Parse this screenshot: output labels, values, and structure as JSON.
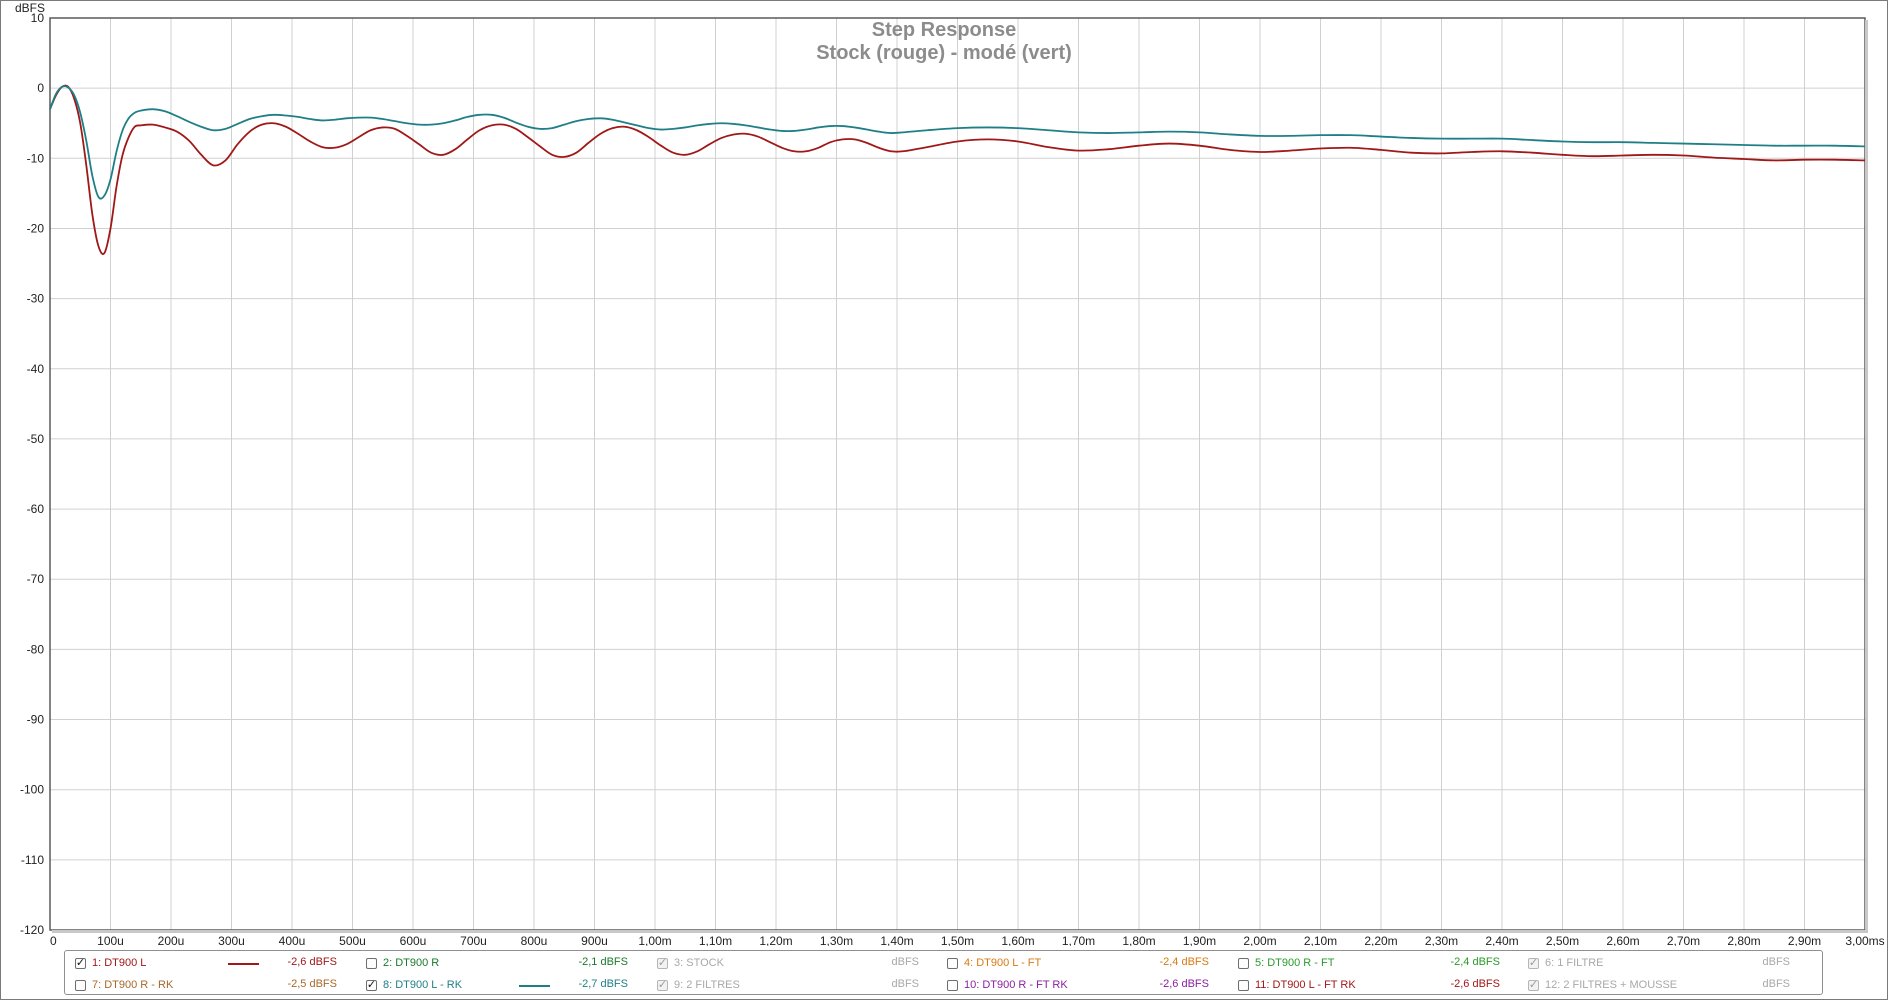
{
  "chart_data": {
    "type": "line",
    "title": "Step Response",
    "subtitle": "Stock (rouge) - modé (vert)",
    "ylabel": "dBFS",
    "xlabel": "",
    "xlim": [
      0,
      3.0
    ],
    "ylim": [
      -120,
      10
    ],
    "grid": true,
    "x_unit": "ms",
    "y_ticks": [
      10,
      0,
      -10,
      -20,
      -30,
      -40,
      -50,
      -60,
      -70,
      -80,
      -90,
      -100,
      -110,
      -120
    ],
    "y_tick_labels": [
      "10",
      "0",
      "-10",
      "-20",
      "-30",
      "-40",
      "-50",
      "-60",
      "-70",
      "-80",
      "-90",
      "-100",
      "-110",
      "-120"
    ],
    "x_ticks": [
      0,
      0.1,
      0.2,
      0.3,
      0.4,
      0.5,
      0.6,
      0.7,
      0.8,
      0.9,
      1.0,
      1.1,
      1.2,
      1.3,
      1.4,
      1.5,
      1.6,
      1.7,
      1.8,
      1.9,
      2.0,
      2.1,
      2.2,
      2.3,
      2.4,
      2.5,
      2.6,
      2.7,
      2.8,
      2.9,
      3.0
    ],
    "x_tick_labels": [
      "0",
      "100u",
      "200u",
      "300u",
      "400u",
      "500u",
      "600u",
      "700u",
      "800u",
      "900u",
      "1,00m",
      "1,10m",
      "1,20m",
      "1,30m",
      "1,40m",
      "1,50m",
      "1,60m",
      "1,70m",
      "1,80m",
      "1,90m",
      "2,00m",
      "2,10m",
      "2,20m",
      "2,30m",
      "2,40m",
      "2,50m",
      "2,60m",
      "2,70m",
      "2,80m",
      "2,90m",
      "3,00ms"
    ],
    "series": [
      {
        "name": "1: DT900 L",
        "color": "#a01818",
        "x": [
          0,
          0.01,
          0.02,
          0.03,
          0.04,
          0.05,
          0.06,
          0.07,
          0.08,
          0.09,
          0.1,
          0.11,
          0.12,
          0.13,
          0.14,
          0.15,
          0.17,
          0.19,
          0.21,
          0.23,
          0.25,
          0.27,
          0.29,
          0.31,
          0.33,
          0.35,
          0.37,
          0.39,
          0.41,
          0.43,
          0.45,
          0.47,
          0.49,
          0.51,
          0.53,
          0.55,
          0.57,
          0.59,
          0.61,
          0.63,
          0.65,
          0.67,
          0.69,
          0.71,
          0.73,
          0.75,
          0.77,
          0.79,
          0.81,
          0.83,
          0.85,
          0.87,
          0.89,
          0.91,
          0.93,
          0.95,
          0.97,
          0.99,
          1.01,
          1.03,
          1.05,
          1.07,
          1.09,
          1.11,
          1.13,
          1.15,
          1.17,
          1.19,
          1.21,
          1.23,
          1.25,
          1.27,
          1.29,
          1.31,
          1.33,
          1.35,
          1.37,
          1.39,
          1.41,
          1.45,
          1.5,
          1.55,
          1.6,
          1.65,
          1.7,
          1.75,
          1.8,
          1.85,
          1.9,
          1.95,
          2.0,
          2.05,
          2.1,
          2.15,
          2.2,
          2.25,
          2.3,
          2.35,
          2.4,
          2.45,
          2.5,
          2.55,
          2.6,
          2.65,
          2.7,
          2.75,
          2.8,
          2.85,
          2.9,
          2.95,
          3.0
        ],
        "y": [
          -3,
          -1,
          0.2,
          0.2,
          -1.5,
          -5,
          -11,
          -18,
          -22.5,
          -23.5,
          -20,
          -14,
          -9.5,
          -7,
          -5.5,
          -5.3,
          -5.2,
          -5.6,
          -6.2,
          -7.5,
          -9.5,
          -11,
          -10.3,
          -8,
          -6.2,
          -5.2,
          -5,
          -5.5,
          -6.5,
          -7.6,
          -8.4,
          -8.5,
          -8,
          -7,
          -6,
          -5.6,
          -5.8,
          -6.8,
          -8,
          -9.2,
          -9.5,
          -8.7,
          -7.3,
          -6,
          -5.3,
          -5.2,
          -5.8,
          -7,
          -8.3,
          -9.5,
          -9.8,
          -9.2,
          -7.8,
          -6.5,
          -5.7,
          -5.5,
          -6,
          -7,
          -8.2,
          -9.2,
          -9.5,
          -9,
          -8,
          -7.1,
          -6.6,
          -6.5,
          -6.9,
          -7.7,
          -8.5,
          -9,
          -9,
          -8.5,
          -7.7,
          -7.3,
          -7.3,
          -7.8,
          -8.5,
          -9,
          -9,
          -8.4,
          -7.6,
          -7.3,
          -7.6,
          -8.4,
          -8.9,
          -8.7,
          -8.2,
          -7.9,
          -8.2,
          -8.8,
          -9.1,
          -8.9,
          -8.6,
          -8.5,
          -8.8,
          -9.2,
          -9.3,
          -9.1,
          -9,
          -9.2,
          -9.5,
          -9.7,
          -9.6,
          -9.5,
          -9.6,
          -9.9,
          -10.1,
          -10.3,
          -10.2,
          -10.2,
          -10.3
        ],
        "legend_value": "-2,6 dBFS",
        "visible": true
      },
      {
        "name": "8: DT900 L - RK",
        "color": "#1f7f86",
        "x": [
          0,
          0.01,
          0.02,
          0.03,
          0.04,
          0.05,
          0.06,
          0.07,
          0.08,
          0.09,
          0.1,
          0.11,
          0.12,
          0.13,
          0.14,
          0.15,
          0.17,
          0.19,
          0.21,
          0.23,
          0.25,
          0.27,
          0.29,
          0.31,
          0.33,
          0.35,
          0.37,
          0.39,
          0.41,
          0.43,
          0.45,
          0.47,
          0.49,
          0.51,
          0.53,
          0.55,
          0.57,
          0.59,
          0.61,
          0.63,
          0.65,
          0.67,
          0.69,
          0.71,
          0.73,
          0.75,
          0.77,
          0.79,
          0.81,
          0.83,
          0.85,
          0.87,
          0.89,
          0.91,
          0.93,
          0.95,
          0.97,
          0.99,
          1.01,
          1.03,
          1.05,
          1.07,
          1.09,
          1.11,
          1.13,
          1.15,
          1.17,
          1.19,
          1.21,
          1.23,
          1.25,
          1.27,
          1.29,
          1.31,
          1.33,
          1.35,
          1.37,
          1.39,
          1.41,
          1.45,
          1.5,
          1.55,
          1.6,
          1.65,
          1.7,
          1.75,
          1.8,
          1.85,
          1.9,
          1.95,
          2.0,
          2.05,
          2.1,
          2.15,
          2.2,
          2.25,
          2.3,
          2.35,
          2.4,
          2.45,
          2.5,
          2.55,
          2.6,
          2.65,
          2.7,
          2.75,
          2.8,
          2.85,
          2.9,
          2.95,
          3.0
        ],
        "y": [
          -3,
          -0.8,
          0.2,
          0.1,
          -1,
          -3.5,
          -7.5,
          -12.5,
          -15.5,
          -15.3,
          -13,
          -9,
          -6,
          -4.3,
          -3.5,
          -3.2,
          -3,
          -3.3,
          -4,
          -4.8,
          -5.5,
          -6,
          -5.8,
          -5.1,
          -4.4,
          -4,
          -3.8,
          -3.9,
          -4.1,
          -4.4,
          -4.6,
          -4.5,
          -4.3,
          -4.2,
          -4.2,
          -4.4,
          -4.7,
          -5,
          -5.2,
          -5.2,
          -5,
          -4.6,
          -4.1,
          -3.8,
          -3.8,
          -4.2,
          -4.9,
          -5.5,
          -5.8,
          -5.7,
          -5.2,
          -4.7,
          -4.4,
          -4.3,
          -4.5,
          -4.9,
          -5.3,
          -5.7,
          -5.9,
          -5.8,
          -5.6,
          -5.3,
          -5.1,
          -5,
          -5.1,
          -5.3,
          -5.6,
          -5.9,
          -6.1,
          -6.1,
          -5.9,
          -5.6,
          -5.4,
          -5.4,
          -5.6,
          -5.9,
          -6.2,
          -6.4,
          -6.3,
          -6,
          -5.7,
          -5.6,
          -5.7,
          -6,
          -6.3,
          -6.4,
          -6.3,
          -6.2,
          -6.3,
          -6.6,
          -6.8,
          -6.8,
          -6.7,
          -6.7,
          -6.9,
          -7.1,
          -7.2,
          -7.2,
          -7.2,
          -7.4,
          -7.6,
          -7.7,
          -7.7,
          -7.8,
          -7.9,
          -8.0,
          -8.1,
          -8.2,
          -8.2,
          -8.2,
          -8.3
        ],
        "legend_value": "-2,7 dBFS",
        "visible": true
      }
    ]
  },
  "legend": {
    "rows": [
      [
        {
          "label": "1: DT900 L",
          "value": "-2,6 dBFS",
          "color": "#a01818",
          "valueColor": "#a01818",
          "checked": true,
          "disabled": false,
          "line": true
        },
        {
          "label": "2: DT900 R",
          "value": "-2,1 dBFS",
          "color": "#1a7a2a",
          "valueColor": "#1a7a2a",
          "checked": false,
          "disabled": false,
          "line": false
        },
        {
          "label": "3: STOCK",
          "value": "dBFS",
          "color": "#a8a8a8",
          "valueColor": "#a8a8a8",
          "checked": true,
          "disabled": true,
          "line": false
        },
        {
          "label": "4: DT900 L - FT",
          "value": "-2,4 dBFS",
          "color": "#d97a10",
          "valueColor": "#d97a10",
          "checked": false,
          "disabled": false,
          "line": false
        },
        {
          "label": "5: DT900 R - FT",
          "value": "-2,4 dBFS",
          "color": "#2a9a2a",
          "valueColor": "#2a9a2a",
          "checked": false,
          "disabled": false,
          "line": false
        },
        {
          "label": "6: 1 FILTRE",
          "value": "dBFS",
          "color": "#a8a8a8",
          "valueColor": "#a8a8a8",
          "checked": true,
          "disabled": true,
          "line": false
        }
      ],
      [
        {
          "label": "7: DT900 R - RK",
          "value": "-2,5 dBFS",
          "color": "#a8682a",
          "valueColor": "#a8682a",
          "checked": false,
          "disabled": false,
          "line": false
        },
        {
          "label": "8: DT900 L - RK",
          "value": "-2,7 dBFS",
          "color": "#1f7f86",
          "valueColor": "#1f7f86",
          "checked": true,
          "disabled": false,
          "line": true
        },
        {
          "label": "9: 2 FILTRES",
          "value": "dBFS",
          "color": "#a8a8a8",
          "valueColor": "#a8a8a8",
          "checked": true,
          "disabled": true,
          "line": false
        },
        {
          "label": "10: DT900 R - FT RK",
          "value": "-2,6 dBFS",
          "color": "#8a1fa0",
          "valueColor": "#8a1fa0",
          "checked": false,
          "disabled": false,
          "line": false
        },
        {
          "label": "11: DT900 L - FT RK",
          "value": "-2,6 dBFS",
          "color": "#a01818",
          "valueColor": "#a01818",
          "checked": false,
          "disabled": false,
          "line": false
        },
        {
          "label": "12: 2 FILTRES + MOUSSE",
          "value": "dBFS",
          "color": "#a8a8a8",
          "valueColor": "#a8a8a8",
          "checked": true,
          "disabled": true,
          "line": false
        }
      ]
    ]
  }
}
